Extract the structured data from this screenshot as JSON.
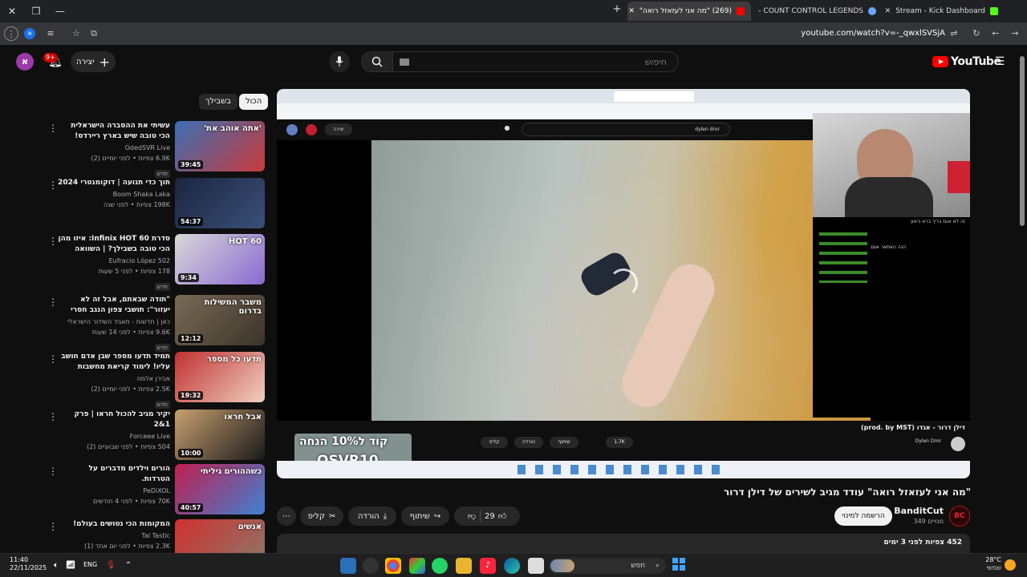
{
  "browser": {
    "tabs": [
      {
        "title": "Stream - Kick Dashboard",
        "color": "#53fc18"
      },
      {
        "title": "COUNT CONTROL LEGENDS - ",
        "color": "#6aa6ff"
      },
      {
        "title": "(269) \"מה אני לעזאזל רואה\"",
        "color": "#ff0000"
      }
    ],
    "url": "youtube.com/watch?v=-_qwxlSVSjA",
    "profile": "א"
  },
  "header": {
    "search_placeholder": "חיפוש",
    "create_label": "יצירה",
    "notifications": "9+",
    "avatar_letter": "א",
    "logo": "YouTube"
  },
  "chips": [
    "הכול",
    "בשבילך"
  ],
  "recommendations": [
    {
      "title": "עשיתי את ההסברה הישראלית הכי טובה שיש בארץ ריירדס! (מצחיק ...",
      "channel": "OdedSVR Live",
      "meta": "6.9K צפיות • לפני יומיים (2)",
      "badge": "חדש",
      "duration": "39:45",
      "c1": "#3a6fb5",
      "c2": "#c83a3a",
      "thumb_text": "'אתה אוהב את'"
    },
    {
      "title": "תוך כדי תנועה | דוקומנטרי 2024",
      "channel": "Boom Shaka Laka",
      "meta": "198K צפיות • לפני שנה",
      "badge": "",
      "duration": "54:37",
      "c1": "#1c2540",
      "c2": "#3a5078",
      "thumb_text": ""
    },
    {
      "title": "סדרת Infinix HOT 60: איזו מהן הכי טובה בשבילך? | השוואה מלאה",
      "channel": "Eufracio López 502",
      "meta": "178 צפיות • לפני 5 שעות",
      "badge": "חדש",
      "duration": "9:34",
      "c1": "#d8d8d8",
      "c2": "#8a6ad0",
      "thumb_text": "HOT 60"
    },
    {
      "title": "\"תודה שבאתם, אבל זה לא יעזור\": תושבי צפון הנגב חסרי אונים מול גל ...",
      "channel": "כאן | חדשות - תאגיד השידור הישראלי",
      "meta": "9.6K צפיות • לפני 14 שעות",
      "badge": "חדש",
      "duration": "12:12",
      "c1": "#7a6a55",
      "c2": "#3a342a",
      "thumb_text": "משבר המשילות בדרום"
    },
    {
      "title": "תמיד תדעו מספר שבן אדם חושב עליו! לימוד קריאת מחשבות מטורף!",
      "channel": "אבירן אלמוז",
      "meta": "2.5K צפיות • לפני יומיים (2)",
      "badge": "חדש",
      "duration": "19:32",
      "c1": "#c03030",
      "c2": "#f0d0c0",
      "thumb_text": "תדעו כל מספר"
    },
    {
      "title": "יקיר מגיב להכול חראו | פרק 1&2",
      "channel": "Forceee Live",
      "meta": "504 צפיות • לפני שבועיים (2)",
      "badge": "",
      "duration": "10:00",
      "c1": "#c8a070",
      "c2": "#1a1a1a",
      "thumb_text": "אבל חראו"
    },
    {
      "title": "הורים וילדים מדברים על הטרדות.",
      "channel": "PeDiXOL",
      "meta": "70K צפיות • לפני 4 חודשים",
      "badge": "",
      "duration": "40:57",
      "c1": "#c02050",
      "c2": "#4080d0",
      "thumb_text": "כשההורים גיליתי"
    },
    {
      "title": "המקומות הכי נטושים בעולם!",
      "channel": "Tal Tastic",
      "meta": "2.3K צפיות • לפני יום אחד (1)",
      "badge": "",
      "duration": "",
      "c1": "#d03030",
      "c2": "#8a7a6a",
      "thumb_text": "אנשים"
    }
  ],
  "player": {
    "inner_search": "dylen dror",
    "inner_create": "יצירה",
    "inner_title": "דילן דרור - אגדו (prod. by MST)",
    "inner_channel": "Dylen Dror",
    "inner_likes": "1.7K",
    "inner_share": "שיתוף",
    "inner_download": "הורדה",
    "inner_clip": "קליפ",
    "promo_line1": "קוד ל10% הנחה",
    "promo_line2": "OSVR10",
    "chat_title": "זה לא אגם בריך ברא ביאון",
    "chat_line": "הנה האתאר אגם"
  },
  "video": {
    "title": "\"מה אני לעזאזל רואה\" עודד מגיב לשירים של דילן דרור",
    "channel": "BanditCut",
    "channel_abbr": "BC",
    "subscribers": "349 מנויים",
    "subscribe_label": "הרשמה למינוי",
    "likes": "29",
    "share_label": "שיתוף",
    "download_label": "הורדה",
    "clip_label": "קליפ",
    "views_date": "452 צפיות  לפני 3 ימים"
  },
  "taskbar": {
    "search_label": "חפש",
    "lang": "ENG",
    "time": "11:40",
    "date": "22/11/2025",
    "temp": "28°C",
    "weather": "שמשי"
  }
}
